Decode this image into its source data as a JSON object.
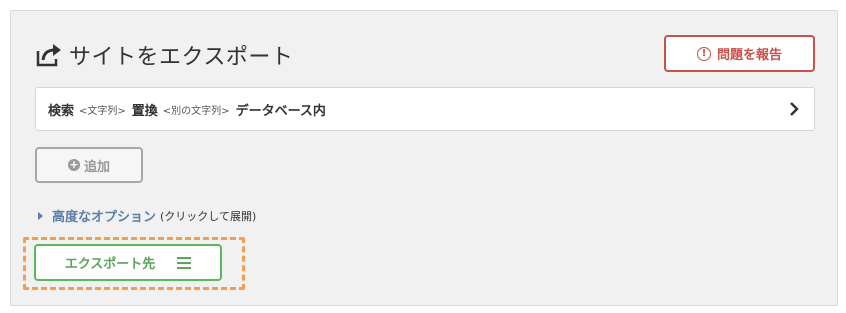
{
  "header": {
    "title": "サイトをエクスポート",
    "report_label": "問題を報告"
  },
  "search_row": {
    "search_label": "検索",
    "search_placeholder": "<文字列>",
    "replace_label": "置換",
    "replace_placeholder": "<別の文字列>",
    "scope_label": "データベース内"
  },
  "add_button": {
    "label": "追加"
  },
  "advanced": {
    "link_label": "高度なオプション",
    "hint": "(クリックして展開)"
  },
  "export_button": {
    "label": "エクスポート先"
  },
  "colors": {
    "danger": "#c9514b",
    "success": "#5cb85c",
    "link": "#5b7fa6",
    "highlight": "#f0a050"
  }
}
